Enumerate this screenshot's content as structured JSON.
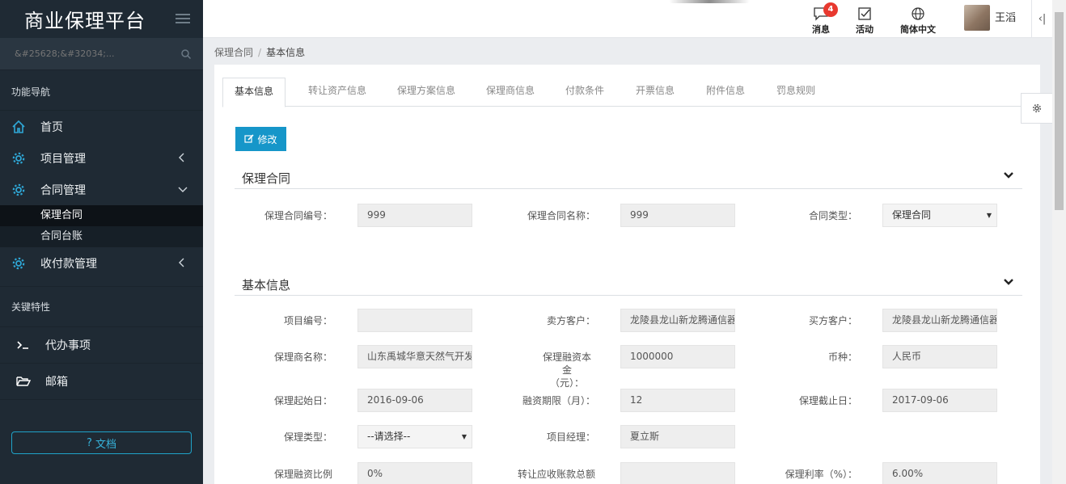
{
  "sidebar": {
    "brand": "商业保理平台",
    "search_placeholder": "&#25628;&#32034;...",
    "nav_label": "功能导航",
    "nav_items": [
      {
        "label": "首页"
      },
      {
        "label": "项目管理"
      },
      {
        "label": "合同管理"
      },
      {
        "label": "收付款管理"
      }
    ],
    "contract_sub": [
      {
        "label": "保理合同"
      },
      {
        "label": "合同台账"
      }
    ],
    "feature_label": "关键特性",
    "feature_items": [
      {
        "label": "代办事项"
      },
      {
        "label": "邮箱"
      }
    ],
    "doc_button": "文档"
  },
  "topbar": {
    "messages_label": "消息",
    "messages_count": "4",
    "activity_label": "活动",
    "language_label": "简体中文",
    "username": "王滔"
  },
  "breadcrumb": {
    "parent": "保理合同",
    "separator": "/",
    "current": "基本信息"
  },
  "tabs": [
    {
      "label": "基本信息"
    },
    {
      "label": "转让资产信息"
    },
    {
      "label": "保理方案信息"
    },
    {
      "label": "保理商信息"
    },
    {
      "label": "付款条件"
    },
    {
      "label": "开票信息"
    },
    {
      "label": "附件信息"
    },
    {
      "label": "罚息规则"
    }
  ],
  "edit_button": "修改",
  "sections": {
    "contract": {
      "title": "保理合同",
      "fields": {
        "contract_no": {
          "label": "保理合同编号：",
          "value": "999"
        },
        "contract_name": {
          "label": "保理合同名称：",
          "value": "999"
        },
        "contract_type": {
          "label": "合同类型：",
          "value": "保理合同"
        }
      }
    },
    "basic": {
      "title": "基本信息",
      "fields": {
        "project_no": {
          "label": "项目编号：",
          "value": ""
        },
        "seller": {
          "label": "卖方客户：",
          "value": "龙陵县龙山新龙腾通信器材"
        },
        "buyer": {
          "label": "买方客户：",
          "value": "龙陵县龙山新龙腾通信器材"
        },
        "factor_name": {
          "label": "保理商名称：",
          "value": "山东禹城华意天然气开发有限公司"
        },
        "principal_line1": {
          "label": "保理融资本金",
          "value": "1000000"
        },
        "principal_line2": {
          "label": "（元）："
        },
        "currency": {
          "label": "币种：",
          "value": "人民币"
        },
        "start_date": {
          "label": "保理起始日：",
          "value": "2016-09-06"
        },
        "term": {
          "label": "融资期限（月）：",
          "value": "12"
        },
        "end_date": {
          "label": "保理截止日：",
          "value": "2017-09-06"
        },
        "factoring_type": {
          "label": "保理类型：",
          "value": "--请选择--"
        },
        "manager": {
          "label": "项目经理：",
          "value": "夏立斯"
        },
        "financing_ratio": {
          "label": "保理融资比例",
          "value": "0%"
        },
        "transfer_total": {
          "label": "转让应收账款总额",
          "value": ""
        },
        "rate": {
          "label": "保理利率（%）：",
          "value": "6.00%"
        }
      }
    }
  },
  "colors": {
    "sidebar_bg": "#1f2a34",
    "accent": "#1696c9",
    "badge": "#e8392f"
  }
}
